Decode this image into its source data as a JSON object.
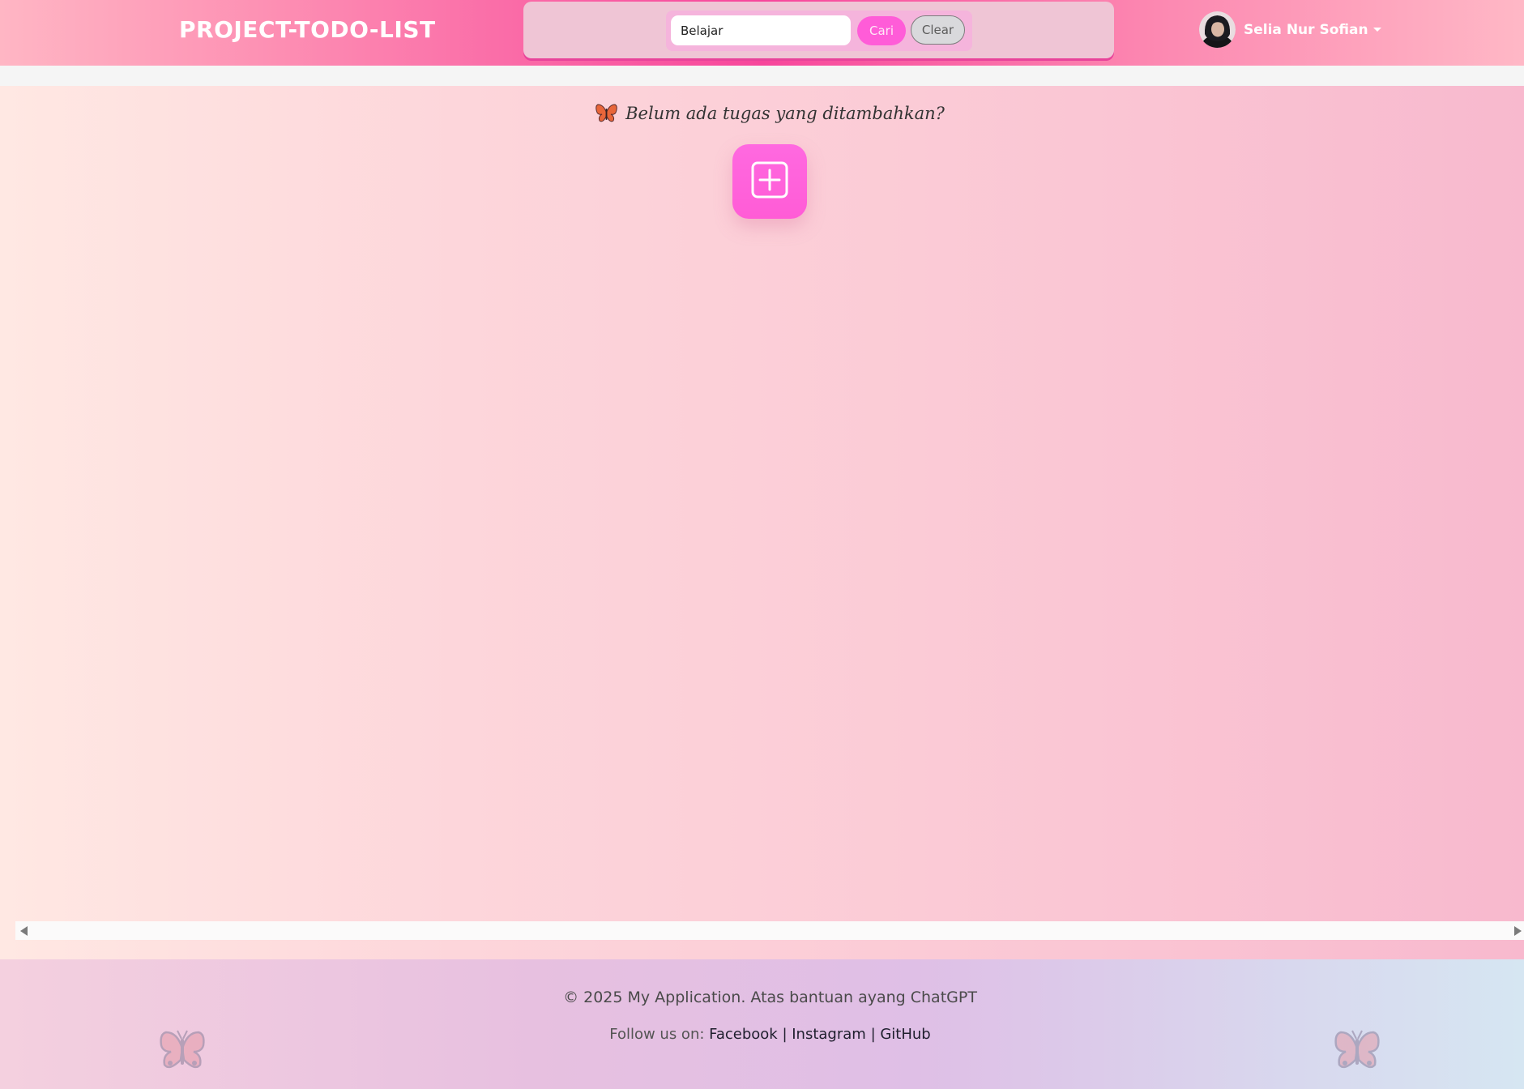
{
  "navbar": {
    "brand": "PROJECT-TODO-LIST",
    "search": {
      "value": "Belajar",
      "submit_label": "Cari",
      "clear_label": "Clear"
    },
    "user": {
      "name": "Selia Nur Sofian",
      "avatar_icon": "user-avatar",
      "dropdown_icon": "caret-down-icon"
    }
  },
  "main": {
    "empty_message": "Belum ada tugas yang ditambahkan?",
    "empty_icon": "butterfly-icon",
    "add_button_icon": "plus-square-icon"
  },
  "footer": {
    "copyright": "© 2025 My Application. Atas bantuan ayang ChatGPT",
    "follow_prefix": "Follow us on:",
    "links": [
      "Facebook",
      "Instagram",
      "GitHub"
    ],
    "separator": "|",
    "decor_icon": "butterfly-icon"
  },
  "colors": {
    "accent_pink": "#ff5cd8",
    "navbar_center": "#f7469b",
    "panel": "#efc5d5"
  }
}
